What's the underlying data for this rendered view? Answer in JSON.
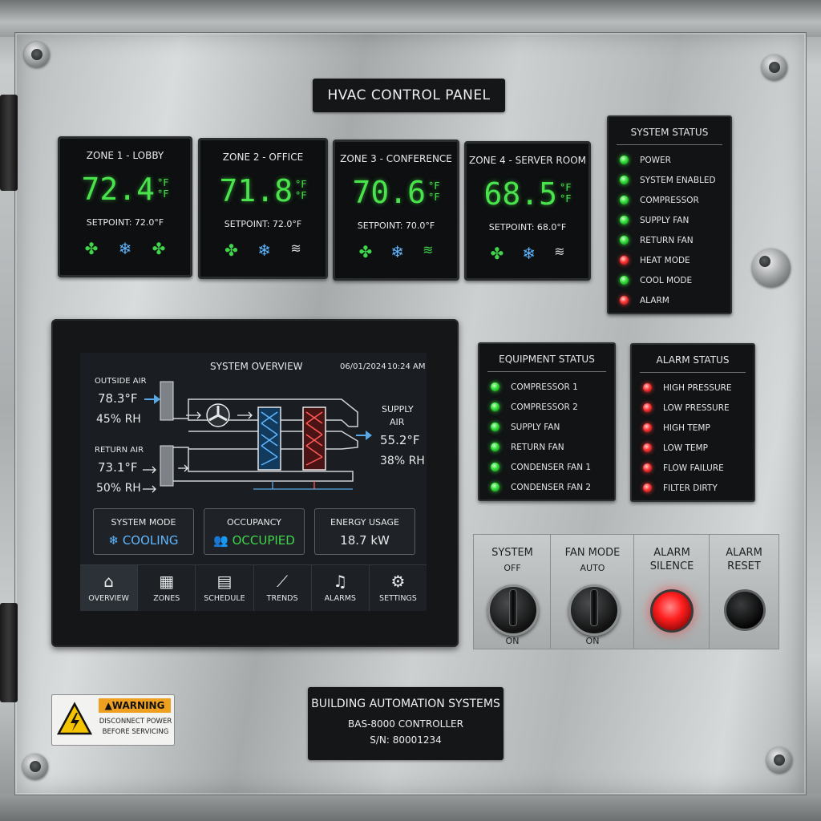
{
  "panel_title": "HVAC CONTROL PANEL",
  "zones": [
    {
      "name": "ZONE 1 - LOBBY",
      "temp": "72.4",
      "unit_top": "°F",
      "unit_bottom": "°F",
      "setpoint": "SETPOINT: 72.0°F",
      "icons": [
        "fan-icon",
        "snowflake-icon",
        "fan-icon"
      ]
    },
    {
      "name": "ZONE 2 - OFFICE",
      "temp": "71.8",
      "unit_top": "°F",
      "unit_bottom": "°F",
      "setpoint": "SETPOINT: 72.0°F",
      "icons": [
        "fan-icon",
        "snowflake-icon",
        "heat-icon"
      ]
    },
    {
      "name": "ZONE 3 - CONFERENCE",
      "temp": "70.6",
      "unit_top": "°F",
      "unit_bottom": "°F",
      "setpoint": "SETPOINT: 70.0°F",
      "icons": [
        "fan-icon",
        "snowflake-icon",
        "heat-icon"
      ]
    },
    {
      "name": "ZONE 4 - SERVER ROOM",
      "temp": "68.5",
      "unit_top": "°F",
      "unit_bottom": "°F",
      "setpoint": "SETPOINT: 68.0°F",
      "icons": [
        "fan-icon",
        "snowflake-icon",
        "heat-icon"
      ]
    }
  ],
  "system_status": {
    "title": "SYSTEM STATUS",
    "items": [
      {
        "label": "POWER",
        "state": "green"
      },
      {
        "label": "SYSTEM ENABLED",
        "state": "green"
      },
      {
        "label": "COMPRESSOR",
        "state": "green"
      },
      {
        "label": "SUPPLY FAN",
        "state": "green"
      },
      {
        "label": "RETURN FAN",
        "state": "green"
      },
      {
        "label": "HEAT MODE",
        "state": "red"
      },
      {
        "label": "COOL MODE",
        "state": "green"
      },
      {
        "label": "ALARM",
        "state": "red"
      }
    ]
  },
  "equipment_status": {
    "title": "EQUIPMENT STATUS",
    "items": [
      {
        "label": "COMPRESSOR 1",
        "state": "green"
      },
      {
        "label": "COMPRESSOR 2",
        "state": "green"
      },
      {
        "label": "SUPPLY FAN",
        "state": "green"
      },
      {
        "label": "RETURN FAN",
        "state": "green"
      },
      {
        "label": "CONDENSER FAN 1",
        "state": "green"
      },
      {
        "label": "CONDENSER FAN 2",
        "state": "green"
      }
    ]
  },
  "alarm_status": {
    "title": "ALARM STATUS",
    "items": [
      {
        "label": "HIGH PRESSURE",
        "state": "red"
      },
      {
        "label": "LOW PRESSURE",
        "state": "red"
      },
      {
        "label": "HIGH TEMP",
        "state": "red"
      },
      {
        "label": "LOW TEMP",
        "state": "red"
      },
      {
        "label": "FLOW FAILURE",
        "state": "red"
      },
      {
        "label": "FILTER DIRTY",
        "state": "red"
      }
    ]
  },
  "screen": {
    "title": "SYSTEM OVERVIEW",
    "date": "06/01/2024",
    "time": "10:24 AM",
    "outside_air": {
      "label": "OUTSIDE AIR",
      "temp": "78.3°F",
      "rh": "45% RH"
    },
    "return_air": {
      "label": "RETURN AIR",
      "temp": "73.1°F",
      "rh": "50% RH"
    },
    "supply_air": {
      "label_1": "SUPPLY",
      "label_2": "AIR",
      "temp": "55.2°F",
      "rh": "38% RH"
    },
    "tiles": [
      {
        "label": "SYSTEM MODE",
        "value": "COOLING",
        "icon": "snowflake-icon"
      },
      {
        "label": "OCCUPANCY",
        "value": "OCCUPIED",
        "icon": "people-icon"
      },
      {
        "label": "ENERGY USAGE",
        "value": "18.7 kW",
        "icon": ""
      }
    ],
    "nav": [
      {
        "label": "OVERVIEW",
        "icon": "home-icon",
        "active": true
      },
      {
        "label": "ZONES",
        "icon": "grid-icon",
        "active": false
      },
      {
        "label": "SCHEDULE",
        "icon": "calendar-icon",
        "active": false
      },
      {
        "label": "TRENDS",
        "icon": "chart-icon",
        "active": false
      },
      {
        "label": "ALARMS",
        "icon": "bell-icon",
        "active": false
      },
      {
        "label": "SETTINGS",
        "icon": "gear-icon",
        "active": false
      }
    ]
  },
  "controls": {
    "system": {
      "label": "SYSTEM",
      "top": "OFF",
      "bottom": "ON"
    },
    "fan_mode": {
      "label": "FAN MODE",
      "top": "AUTO",
      "bottom": "ON"
    },
    "alarm_silence": {
      "label_1": "ALARM",
      "label_2": "SILENCE"
    },
    "alarm_reset": {
      "label_1": "ALARM",
      "label_2": "RESET"
    }
  },
  "warning_label": {
    "heading": "WARNING",
    "line_1": "DISCONNECT POWER",
    "line_2": "BEFORE SERVICING"
  },
  "nameplate": {
    "line_1": "BUILDING AUTOMATION SYSTEMS",
    "line_2": "BAS-8000 CONTROLLER",
    "line_3": "S/N: 80001234"
  },
  "colors": {
    "led_green": "#33dd3a",
    "led_red": "#ff3434",
    "display_green": "#49e34b",
    "cool_blue": "#5fb6ff",
    "occupied_green": "#3fd54a"
  }
}
